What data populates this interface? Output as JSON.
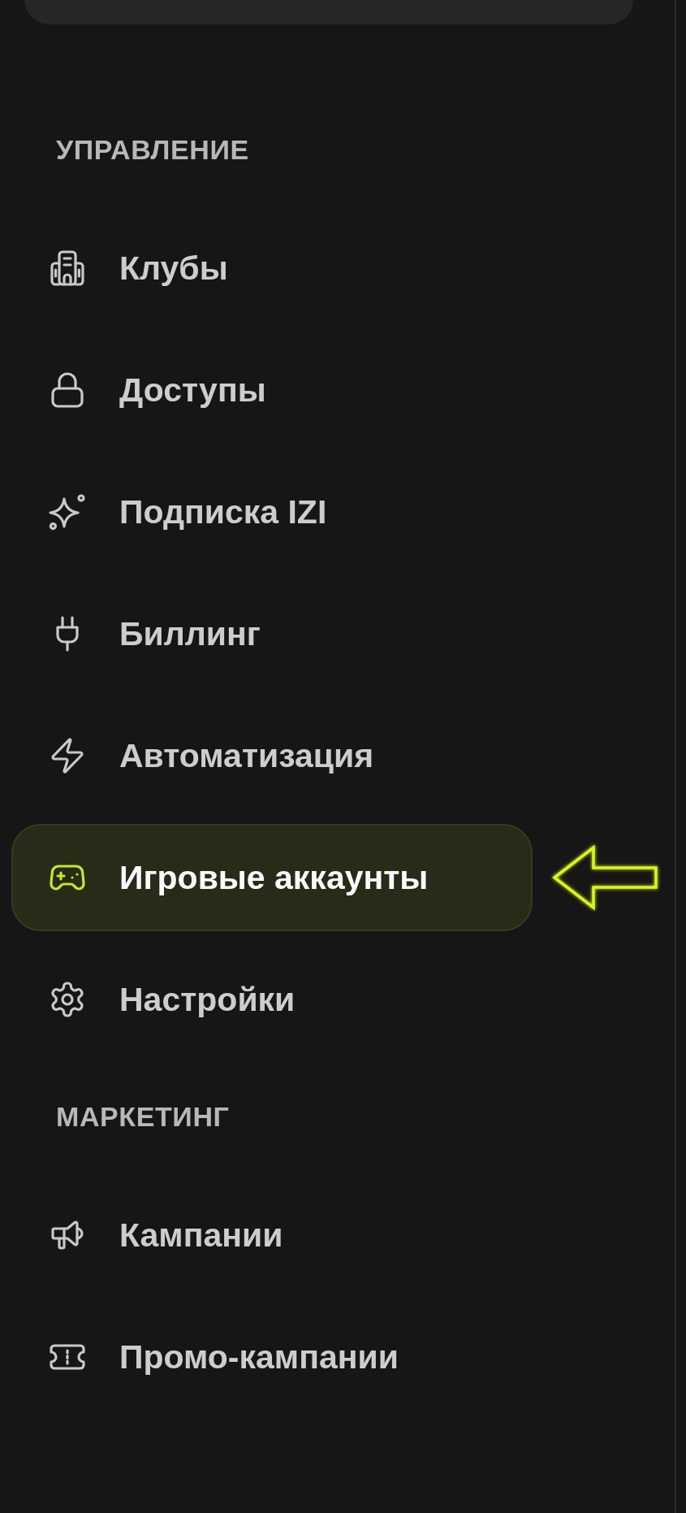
{
  "sidebar": {
    "sections": [
      {
        "title": "УПРАВЛЕНИЕ",
        "items": [
          {
            "label": "Клубы",
            "selected": false
          },
          {
            "label": "Доступы",
            "selected": false
          },
          {
            "label": "Подписка IZI",
            "selected": false
          },
          {
            "label": "Биллинг",
            "selected": false
          },
          {
            "label": "Автоматизация",
            "selected": false
          },
          {
            "label": "Игровые аккаунты",
            "selected": true
          },
          {
            "label": "Настройки",
            "selected": false
          }
        ]
      },
      {
        "title": "МАРКЕТИНГ",
        "items": [
          {
            "label": "Кампании",
            "selected": false
          },
          {
            "label": "Промо-кампании",
            "selected": false
          }
        ]
      }
    ]
  }
}
